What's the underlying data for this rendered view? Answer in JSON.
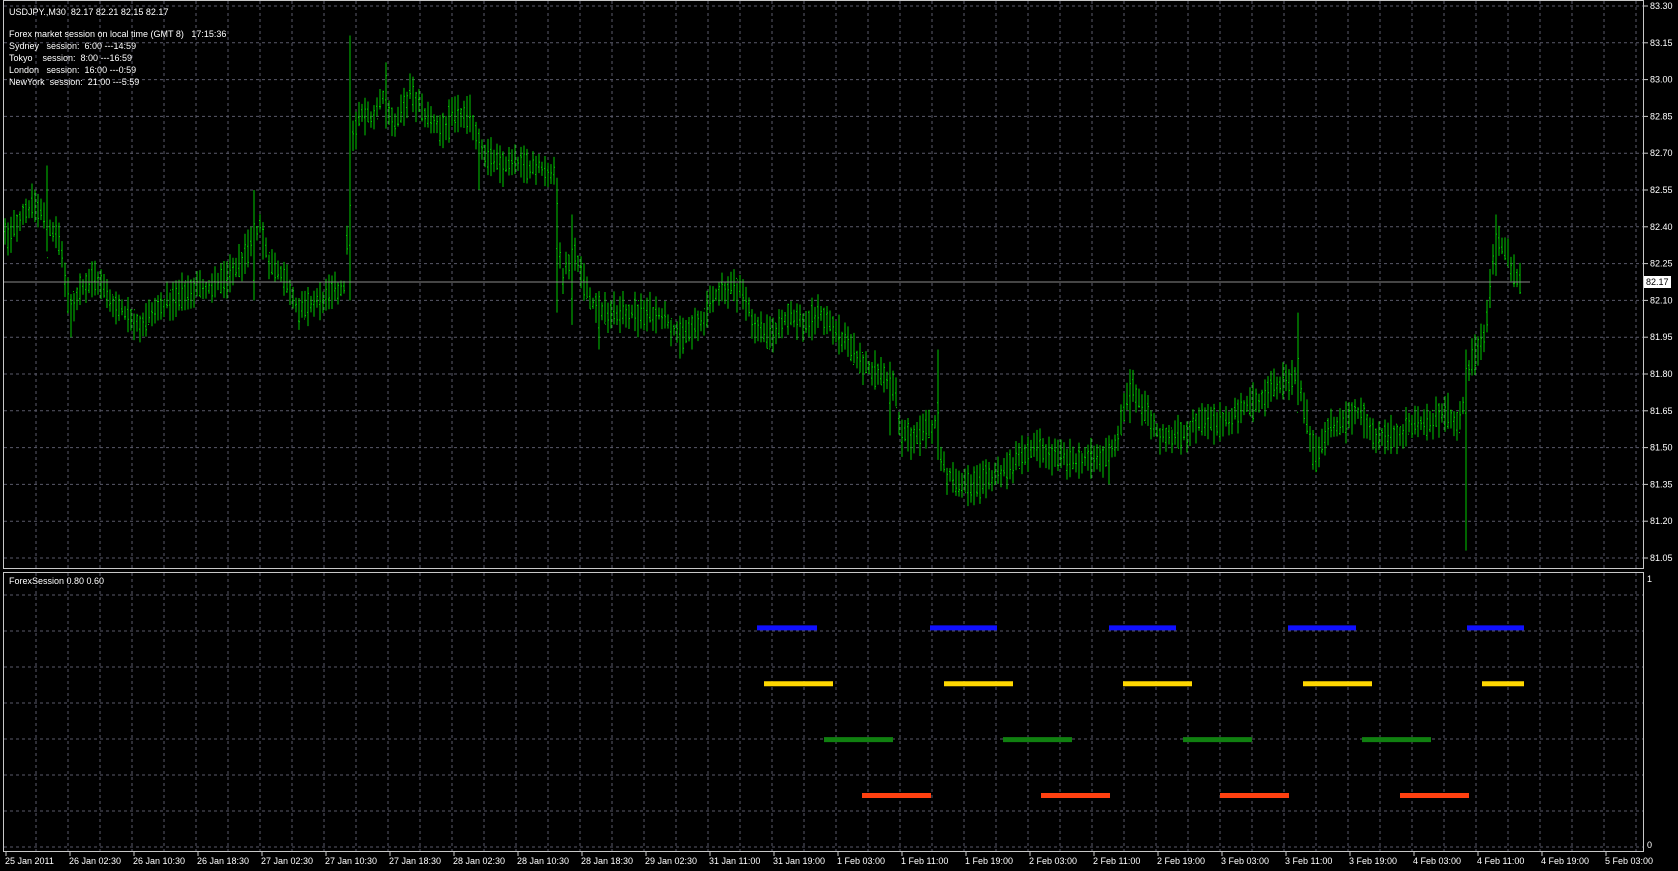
{
  "header": {
    "symbol_line": "USDJPY.,M30  82.17 82.21 82.15 82.17",
    "session_title": "Forex market session on local time (GMT 8)   17:15:36",
    "sessions": [
      "Sydney   session:  6:00 ---14:59",
      "Tokyo    session:  8:00 ---16:59",
      "London   session:  16:00 ---0:59",
      "NewYork  session:  21:00 ---5:59"
    ]
  },
  "indicator": {
    "label": "ForexSession 0.80 0.60",
    "scale_top": "1",
    "scale_bottom": "0",
    "colors": {
      "sydney": "#1010ff",
      "tokyo": "#ffd700",
      "london": "#108010",
      "newyork": "#ff4010"
    }
  },
  "current_price": "82.17",
  "colors": {
    "background": "#000000",
    "bars": "#00c800",
    "grid": "#5a5a6a",
    "frame": "#c8c8c8"
  },
  "chart_data": {
    "type": "bar",
    "series_name": "USDJPY M30",
    "y_ticks": [
      "83.30",
      "83.15",
      "83.00",
      "82.85",
      "82.70",
      "82.55",
      "82.40",
      "82.25",
      "82.10",
      "81.95",
      "81.80",
      "81.65",
      "81.50",
      "81.35",
      "81.20",
      "81.05"
    ],
    "ylim": [
      81.0,
      83.3
    ],
    "x_tick_labels": [
      "25 Jan 2011",
      "26 Jan 02:30",
      "26 Jan 10:30",
      "26 Jan 18:30",
      "27 Jan 02:30",
      "27 Jan 10:30",
      "27 Jan 18:30",
      "28 Jan 02:30",
      "28 Jan 10:30",
      "28 Jan 18:30",
      "29 Jan 02:30",
      "31 Jan 11:00",
      "31 Jan 19:00",
      "1 Feb 03:00",
      "1 Feb 11:00",
      "1 Feb 19:00",
      "2 Feb 03:00",
      "2 Feb 11:00",
      "2 Feb 19:00",
      "3 Feb 03:00",
      "3 Feb 11:00",
      "3 Feb 19:00",
      "4 Feb 03:00",
      "4 Feb 11:00",
      "4 Feb 19:00",
      "5 Feb 03:00"
    ],
    "price_path": [
      [
        0,
        82.4
      ],
      [
        8,
        82.35
      ],
      [
        22,
        82.45
      ],
      [
        35,
        82.5
      ],
      [
        48,
        82.4
      ],
      [
        60,
        82.35
      ],
      [
        70,
        82.05
      ],
      [
        80,
        82.15
      ],
      [
        95,
        82.2
      ],
      [
        110,
        82.1
      ],
      [
        125,
        82.05
      ],
      [
        140,
        82.0
      ],
      [
        155,
        82.05
      ],
      [
        170,
        82.1
      ],
      [
        190,
        82.15
      ],
      [
        210,
        82.15
      ],
      [
        230,
        82.2
      ],
      [
        248,
        82.3
      ],
      [
        260,
        82.4
      ],
      [
        270,
        82.25
      ],
      [
        285,
        82.2
      ],
      [
        300,
        82.05
      ],
      [
        320,
        82.1
      ],
      [
        345,
        82.15
      ],
      [
        352,
        82.75
      ],
      [
        360,
        82.85
      ],
      [
        375,
        82.85
      ],
      [
        385,
        82.95
      ],
      [
        395,
        82.8
      ],
      [
        410,
        82.95
      ],
      [
        425,
        82.85
      ],
      [
        440,
        82.8
      ],
      [
        455,
        82.85
      ],
      [
        470,
        82.85
      ],
      [
        485,
        82.7
      ],
      [
        500,
        82.65
      ],
      [
        520,
        82.65
      ],
      [
        540,
        82.65
      ],
      [
        555,
        82.6
      ],
      [
        562,
        82.2
      ],
      [
        575,
        82.3
      ],
      [
        590,
        82.1
      ],
      [
        605,
        82.05
      ],
      [
        620,
        82.05
      ],
      [
        640,
        82.05
      ],
      [
        660,
        82.05
      ],
      [
        680,
        81.95
      ],
      [
        700,
        82.0
      ],
      [
        720,
        82.15
      ],
      [
        740,
        82.15
      ],
      [
        755,
        82.0
      ],
      [
        770,
        81.95
      ],
      [
        790,
        82.05
      ],
      [
        805,
        82.0
      ],
      [
        820,
        82.05
      ],
      [
        840,
        81.95
      ],
      [
        860,
        81.85
      ],
      [
        880,
        81.8
      ],
      [
        895,
        81.75
      ],
      [
        900,
        81.55
      ],
      [
        920,
        81.55
      ],
      [
        935,
        81.6
      ],
      [
        945,
        81.4
      ],
      [
        960,
        81.35
      ],
      [
        980,
        81.35
      ],
      [
        1000,
        81.4
      ],
      [
        1020,
        81.45
      ],
      [
        1040,
        81.5
      ],
      [
        1060,
        81.45
      ],
      [
        1080,
        81.45
      ],
      [
        1100,
        81.45
      ],
      [
        1115,
        81.5
      ],
      [
        1130,
        81.75
      ],
      [
        1145,
        81.65
      ],
      [
        1160,
        81.55
      ],
      [
        1180,
        81.55
      ],
      [
        1200,
        81.6
      ],
      [
        1220,
        81.6
      ],
      [
        1240,
        81.65
      ],
      [
        1260,
        81.7
      ],
      [
        1280,
        81.75
      ],
      [
        1295,
        81.8
      ],
      [
        1305,
        81.65
      ],
      [
        1315,
        81.45
      ],
      [
        1330,
        81.6
      ],
      [
        1345,
        81.6
      ],
      [
        1360,
        81.65
      ],
      [
        1375,
        81.55
      ],
      [
        1395,
        81.55
      ],
      [
        1415,
        81.6
      ],
      [
        1430,
        81.6
      ],
      [
        1445,
        81.65
      ],
      [
        1460,
        81.6
      ],
      [
        1470,
        81.85
      ],
      [
        1485,
        81.95
      ],
      [
        1495,
        82.35
      ],
      [
        1505,
        82.3
      ],
      [
        1515,
        82.2
      ],
      [
        1522,
        82.17
      ]
    ],
    "spikes": [
      [
        46,
        82.65,
        82.3
      ],
      [
        72,
        82.0,
        81.95
      ],
      [
        253,
        82.55,
        82.1
      ],
      [
        298,
        82.1,
        81.98
      ],
      [
        351,
        83.18,
        82.1
      ],
      [
        385,
        83.07,
        82.8
      ],
      [
        480,
        82.8,
        82.55
      ],
      [
        557,
        82.6,
        82.05
      ],
      [
        573,
        82.45,
        82.0
      ],
      [
        600,
        82.05,
        81.9
      ],
      [
        638,
        82.05,
        81.95
      ],
      [
        692,
        82.0,
        81.9
      ],
      [
        737,
        82.15,
        82.05
      ],
      [
        890,
        81.85,
        81.55
      ],
      [
        910,
        81.55,
        81.45
      ],
      [
        939,
        81.9,
        81.45
      ],
      [
        960,
        81.3,
        81.3
      ],
      [
        1022,
        81.55,
        81.4
      ],
      [
        1108,
        81.55,
        81.35
      ],
      [
        1131,
        81.82,
        81.6
      ],
      [
        1298,
        82.05,
        81.7
      ],
      [
        1315,
        81.55,
        81.4
      ],
      [
        1466,
        81.9,
        81.08
      ],
      [
        1497,
        82.45,
        82.2
      ]
    ],
    "ff_sessions": [
      {
        "name": "Sydney",
        "level": 0.82,
        "color": "#1010ff",
        "segments": [
          [
            757,
            817
          ],
          [
            930,
            997
          ],
          [
            1109,
            1176
          ],
          [
            1288,
            1356
          ],
          [
            1467,
            1524
          ]
        ]
      },
      {
        "name": "Tokyo",
        "level": 0.61,
        "color": "#ffd700",
        "segments": [
          [
            764,
            833
          ],
          [
            944,
            1013
          ],
          [
            1123,
            1192
          ],
          [
            1303,
            1372
          ],
          [
            1482,
            1524
          ]
        ]
      },
      {
        "name": "London",
        "level": 0.4,
        "color": "#108010",
        "segments": [
          [
            824,
            893
          ],
          [
            1003,
            1072
          ],
          [
            1183,
            1252
          ],
          [
            1362,
            1431
          ]
        ]
      },
      {
        "name": "NewYork",
        "level": 0.19,
        "color": "#ff4010",
        "segments": [
          [
            862,
            931
          ],
          [
            1041,
            1110
          ],
          [
            1220,
            1289
          ],
          [
            1400,
            1469
          ]
        ]
      }
    ]
  }
}
